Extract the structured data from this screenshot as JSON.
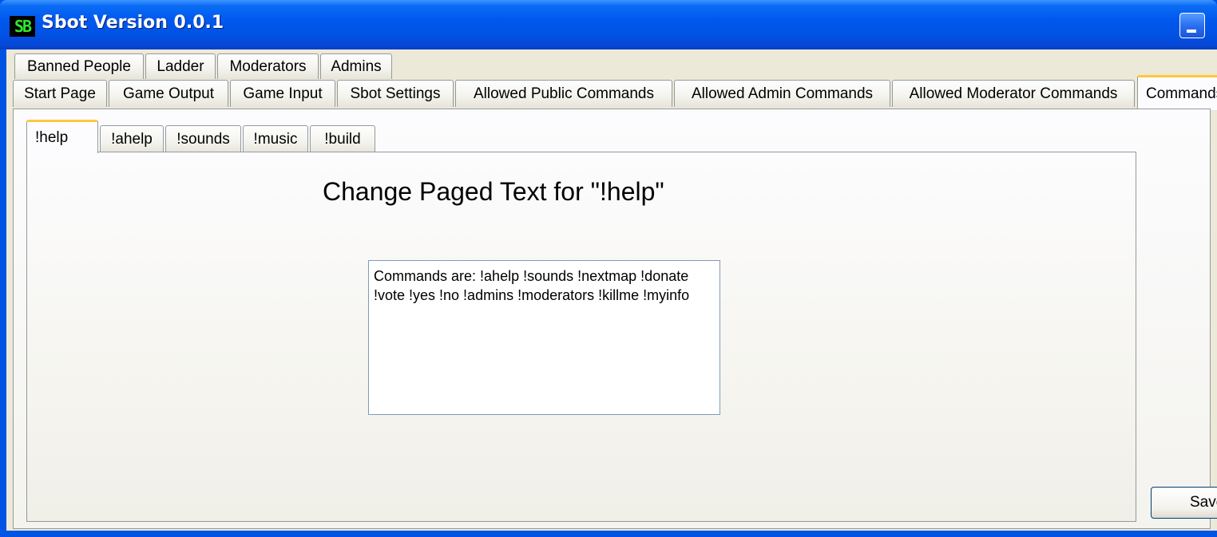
{
  "window": {
    "title": "Sbot Version 0.0.1",
    "logo_text": "SB"
  },
  "tabs": {
    "row_top": [
      {
        "label": "Banned People"
      },
      {
        "label": "Ladder"
      },
      {
        "label": "Moderators"
      },
      {
        "label": "Admins"
      }
    ],
    "row_bottom": [
      {
        "label": "Start Page"
      },
      {
        "label": "Game Output"
      },
      {
        "label": "Game Input"
      },
      {
        "label": "Sbot Settings"
      },
      {
        "label": "Allowed Public Commands"
      },
      {
        "label": "Allowed Admin Commands"
      },
      {
        "label": "Allowed Moderator Commands"
      },
      {
        "label": "Commands",
        "active": true
      }
    ]
  },
  "command_tabs": [
    {
      "label": "!help",
      "active": true
    },
    {
      "label": "!ahelp"
    },
    {
      "label": "!sounds"
    },
    {
      "label": "!music"
    },
    {
      "label": "!build"
    }
  ],
  "editor": {
    "heading": "Change Paged Text for \"!help\"",
    "text": "Commands are: !ahelp !sounds !nextmap !donate !vote !yes !no !admins !moderators !killme !myinfo"
  },
  "actions": {
    "save_label": "Save"
  }
}
